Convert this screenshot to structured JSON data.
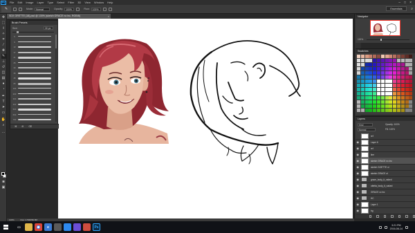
{
  "app": {
    "logo": "Ps",
    "menus": [
      "File",
      "Edit",
      "Image",
      "Layer",
      "Type",
      "Select",
      "Filter",
      "3D",
      "View",
      "Window",
      "Help"
    ]
  },
  "options": {
    "mode_label": "Mode:",
    "mode_value": "Normal",
    "opacity_label": "Opacity:",
    "opacity_value": "100%",
    "flow_label": "Flow:",
    "flow_value": "100%",
    "workspace": "Essentials"
  },
  "document": {
    "tab_title": "SDX GRETTE (18).psd @ 100% (sketch GRACE no inc, RGB/8)",
    "zoom_status": "100%",
    "doc_status": "Doc: 4.59M/60.8M"
  },
  "brush_presets": {
    "title": "Brush Presets",
    "size_label": "Size:",
    "size_value": "30 px",
    "brush_sizes": [
      "5",
      "9",
      "13",
      "17",
      "21",
      "25",
      "30",
      "35",
      "45",
      "65",
      "100",
      "200",
      "300",
      "400",
      "500",
      "600",
      "700"
    ]
  },
  "panels": {
    "navigator": "Navigator",
    "navigator_zoom": "100%",
    "swatches": "Swatches",
    "layers": "Layers",
    "layers_kind": "Kind",
    "layers_mode": "Normal",
    "layers_opacity": "Opacity: 100%",
    "layers_fill": "Fill: 100%"
  },
  "layers": [
    {
      "name": "ref",
      "type": "layer",
      "visible": false,
      "selected": false
    },
    {
      "name": "Layer 6",
      "type": "layer",
      "visible": true,
      "selected": false
    },
    {
      "name": "ref",
      "type": "layer",
      "visible": true,
      "selected": false
    },
    {
      "name": "line",
      "type": "layer",
      "visible": true,
      "selected": false
    },
    {
      "name": "sketch GRACE no inc",
      "type": "layer",
      "visible": true,
      "selected": true
    },
    {
      "name": "sketch GOETTE ol",
      "type": "layer",
      "visible": true,
      "selected": false
    },
    {
      "name": "sketch GRACE ol",
      "type": "layer",
      "visible": true,
      "selected": false
    },
    {
      "name": "grace_body_it_naked",
      "type": "folder",
      "visible": true,
      "selected": false
    },
    {
      "name": "ottetta_body_it_naked",
      "type": "folder",
      "visible": true,
      "selected": false
    },
    {
      "name": "GRACE cc inc",
      "type": "folder",
      "visible": true,
      "selected": false
    },
    {
      "name": "HC",
      "type": "folder",
      "visible": true,
      "selected": false
    },
    {
      "name": "Layer 1",
      "type": "layer",
      "visible": true,
      "selected": false
    },
    {
      "name": "bg",
      "type": "layer",
      "visible": true,
      "selected": false
    }
  ],
  "taskbar": {
    "time": "3:21 PM",
    "date": "2016-08-14"
  },
  "colors": {
    "hair": "#a8343e",
    "skin": "#e8b8a2",
    "accent": "#31a8ff"
  }
}
